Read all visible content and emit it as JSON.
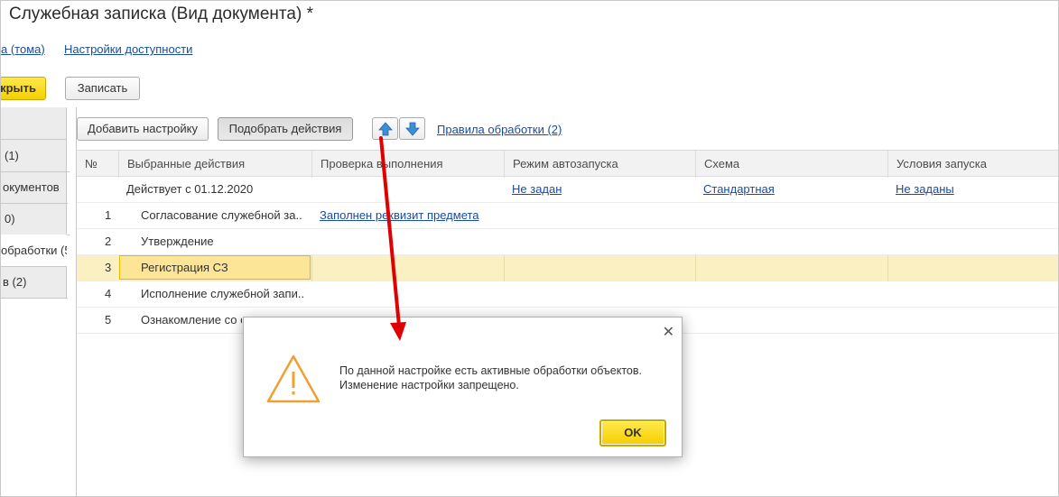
{
  "window": {
    "title": "Служебная записка (Вид документа) *"
  },
  "nav": {
    "link1": "а (тома)",
    "link2": "Настройки доступности"
  },
  "toolbar": {
    "close_label": "крыть",
    "save_label": "Записать"
  },
  "left_tabs": [
    "(1)",
    "окументов",
    "0)",
    "обработки (5",
    "в (2)"
  ],
  "grid_toolbar": {
    "add_setting": "Добавить настройку",
    "pick_actions": "Подобрать действия",
    "move_up_icon": "arrow-up-icon",
    "move_down_icon": "arrow-down-icon",
    "rules_link": "Правила обработки (2)"
  },
  "table": {
    "columns": [
      "№",
      "Выбранные действия",
      "Проверка выполнения",
      "Режим автозапуска",
      "Схема",
      "Условия запуска"
    ],
    "group_row": {
      "action": "Действует с 01.12.2020",
      "autostart": "Не задан",
      "scheme": "Стандартная",
      "conditions": "Не заданы"
    },
    "rows": [
      {
        "num": "1",
        "action": "Согласование служебной за...",
        "check": "Заполнен реквизит предмета"
      },
      {
        "num": "2",
        "action": "Утверждение",
        "check": ""
      },
      {
        "num": "3",
        "action": "Регистрация СЗ",
        "check": ""
      },
      {
        "num": "4",
        "action": "Исполнение служебной запи...",
        "check": ""
      },
      {
        "num": "5",
        "action": "Ознакомление со с",
        "check": ""
      }
    ],
    "selected_row": 3
  },
  "dialog": {
    "icon": "warning-icon",
    "line1": "По данной настройке есть активные обработки объектов.",
    "line2": "Изменение настройки запрещено.",
    "ok_label": "OK",
    "close_icon": "close-icon"
  },
  "colors": {
    "accent_yellow": "#f5cf00",
    "link_blue": "#1a4c9c",
    "warning_orange": "#f0a030",
    "annotation_red": "#e00000"
  }
}
